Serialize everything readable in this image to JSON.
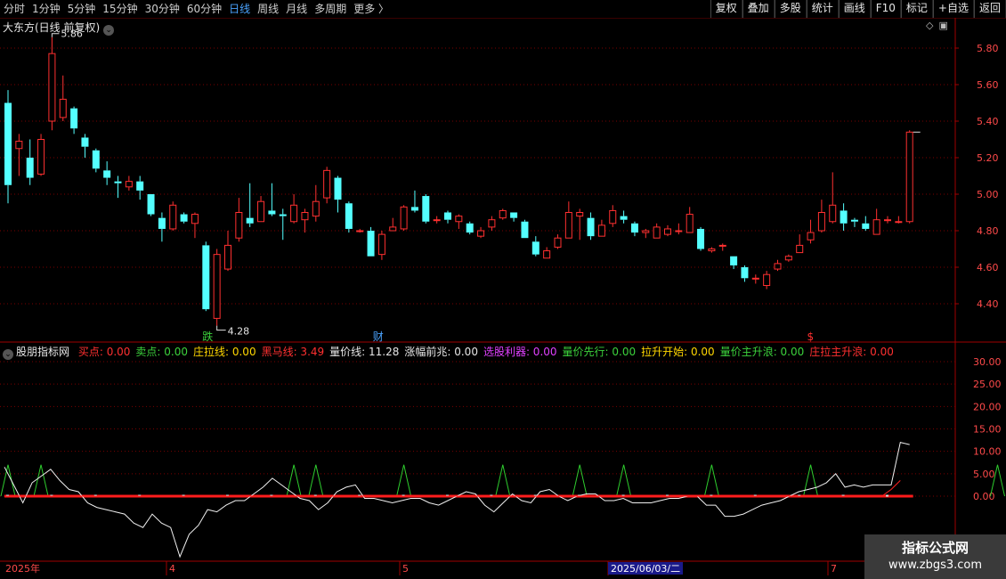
{
  "toolbar": {
    "periods": [
      "分时",
      "1分钟",
      "5分钟",
      "15分钟",
      "30分钟",
      "60分钟",
      "日线",
      "周线",
      "月线",
      "多周期",
      "更多 〉"
    ],
    "active_period": "日线",
    "buttons": [
      "复权",
      "叠加",
      "多股",
      "统计",
      "画线",
      "F10",
      "标记",
      "+自选",
      "返回"
    ]
  },
  "chart_title": "大东方(日线 前复权)",
  "price_axis": [
    "5.80",
    "5.60",
    "5.40",
    "5.20",
    "5.00",
    "4.80",
    "4.60",
    "4.40"
  ],
  "high_label": "5.86",
  "low_label": "4.28",
  "markers": [
    {
      "text": "跌",
      "color": "#3cd23c"
    },
    {
      "text": "财",
      "color": "#4aa3ff"
    },
    {
      "text": "$",
      "color": "#ff3030"
    }
  ],
  "indicator": {
    "name": "股朋指标网",
    "items": [
      {
        "label": "买点: 0.00",
        "color": "#ff3030"
      },
      {
        "label": "卖点: 0.00",
        "color": "#3cd23c"
      },
      {
        "label": "庄拉线: 0.00",
        "color": "#ffd700"
      },
      {
        "label": "黑马线: 3.49",
        "color": "#ff3030"
      },
      {
        "label": "量价线: 11.28",
        "color": "#e6e6e6"
      },
      {
        "label": "涨幅前兆: 0.00",
        "color": "#e6e6e6"
      },
      {
        "label": "选股利器: 0.00",
        "color": "#e040ff"
      },
      {
        "label": "量价先行: 0.00",
        "color": "#3cd23c"
      },
      {
        "label": "拉升开始: 0.00",
        "color": "#ffd700"
      },
      {
        "label": "量价主升浪: 0.00",
        "color": "#3cd23c"
      },
      {
        "label": "庄拉主升浪: 0.00",
        "color": "#ff3030"
      }
    ]
  },
  "indicator_axis": [
    "30.00",
    "25.00",
    "20.00",
    "15.00",
    "10.00",
    "5.00",
    "0.00"
  ],
  "time_axis": [
    "2025年",
    "4",
    "5",
    "2025/06/03/二",
    "7"
  ],
  "watermark": {
    "line1": "指标公式网",
    "line2": "www.zbgs3.com"
  },
  "colors": {
    "up": "#ff3030",
    "down": "#54ffff",
    "grid": "#7a0000",
    "axis_text": "#ff4a4a"
  },
  "candles": [
    [
      5.5,
      5.05,
      5.57,
      4.95
    ],
    [
      5.25,
      5.29,
      5.33,
      5.1
    ],
    [
      5.2,
      5.09,
      5.3,
      5.05
    ],
    [
      5.11,
      5.3,
      5.33,
      5.1
    ],
    [
      5.4,
      5.77,
      5.86,
      5.35
    ],
    [
      5.42,
      5.52,
      5.65,
      5.4
    ],
    [
      5.47,
      5.36,
      5.48,
      5.33
    ],
    [
      5.31,
      5.26,
      5.33,
      5.2
    ],
    [
      5.24,
      5.14,
      5.25,
      5.12
    ],
    [
      5.13,
      5.09,
      5.18,
      5.05
    ],
    [
      5.07,
      5.06,
      5.1,
      4.98
    ],
    [
      5.04,
      5.07,
      5.1,
      5.02
    ],
    [
      5.07,
      5.02,
      5.1,
      4.97
    ],
    [
      5.0,
      4.89,
      5.0,
      4.88
    ],
    [
      4.87,
      4.81,
      4.9,
      4.74
    ],
    [
      4.81,
      4.94,
      4.96,
      4.8
    ],
    [
      4.89,
      4.85,
      4.9,
      4.84
    ],
    [
      4.84,
      4.89,
      4.9,
      4.76
    ],
    [
      4.72,
      4.37,
      4.74,
      4.36
    ],
    [
      4.32,
      4.67,
      4.7,
      4.28
    ],
    [
      4.59,
      4.72,
      4.8,
      4.58
    ],
    [
      4.76,
      4.9,
      4.98,
      4.74
    ],
    [
      4.87,
      4.84,
      5.06,
      4.82
    ],
    [
      4.85,
      4.96,
      4.99,
      4.85
    ],
    [
      4.91,
      4.89,
      5.06,
      4.88
    ],
    [
      4.89,
      4.88,
      4.92,
      4.75
    ],
    [
      4.85,
      4.94,
      5.0,
      4.84
    ],
    [
      4.86,
      4.9,
      4.92,
      4.79
    ],
    [
      4.88,
      4.96,
      5.05,
      4.85
    ],
    [
      4.98,
      5.13,
      5.15,
      4.95
    ],
    [
      5.09,
      4.97,
      5.1,
      4.9
    ],
    [
      4.95,
      4.81,
      4.96,
      4.79
    ],
    [
      4.8,
      4.8,
      4.81,
      4.79
    ],
    [
      4.8,
      4.66,
      4.82,
      4.66
    ],
    [
      4.67,
      4.78,
      4.8,
      4.64
    ],
    [
      4.8,
      4.82,
      4.87,
      4.8
    ],
    [
      4.81,
      4.93,
      4.94,
      4.8
    ],
    [
      4.93,
      4.91,
      5.02,
      4.9
    ],
    [
      4.99,
      4.85,
      5.0,
      4.84
    ],
    [
      4.86,
      4.86,
      4.88,
      4.84
    ],
    [
      4.9,
      4.86,
      4.91,
      4.84
    ],
    [
      4.85,
      4.88,
      4.89,
      4.81
    ],
    [
      4.84,
      4.79,
      4.85,
      4.78
    ],
    [
      4.77,
      4.8,
      4.82,
      4.76
    ],
    [
      4.82,
      4.86,
      4.88,
      4.8
    ],
    [
      4.87,
      4.91,
      4.92,
      4.86
    ],
    [
      4.9,
      4.87,
      4.9,
      4.85
    ],
    [
      4.85,
      4.76,
      4.86,
      4.76
    ],
    [
      4.74,
      4.67,
      4.77,
      4.66
    ],
    [
      4.65,
      4.69,
      4.71,
      4.65
    ],
    [
      4.71,
      4.76,
      4.78,
      4.7
    ],
    [
      4.76,
      4.9,
      4.96,
      4.76
    ],
    [
      4.88,
      4.9,
      4.92,
      4.75
    ],
    [
      4.87,
      4.77,
      4.9,
      4.75
    ],
    [
      4.77,
      4.83,
      4.86,
      4.77
    ],
    [
      4.84,
      4.91,
      4.94,
      4.82
    ],
    [
      4.88,
      4.86,
      4.91,
      4.84
    ],
    [
      4.84,
      4.79,
      4.85,
      4.77
    ],
    [
      4.79,
      4.8,
      4.81,
      4.76
    ],
    [
      4.76,
      4.82,
      4.84,
      4.76
    ],
    [
      4.78,
      4.81,
      4.83,
      4.77
    ],
    [
      4.8,
      4.8,
      4.84,
      4.78
    ],
    [
      4.79,
      4.89,
      4.93,
      4.79
    ],
    [
      4.81,
      4.7,
      4.82,
      4.69
    ],
    [
      4.69,
      4.7,
      4.71,
      4.68
    ],
    [
      4.72,
      4.72,
      4.73,
      4.69
    ],
    [
      4.66,
      4.61,
      4.66,
      4.59
    ],
    [
      4.6,
      4.54,
      4.61,
      4.52
    ],
    [
      4.54,
      4.54,
      4.56,
      4.51
    ],
    [
      4.5,
      4.56,
      4.58,
      4.48
    ],
    [
      4.59,
      4.62,
      4.64,
      4.58
    ],
    [
      4.64,
      4.66,
      4.67,
      4.63
    ],
    [
      4.68,
      4.72,
      4.78,
      4.68
    ],
    [
      4.75,
      4.79,
      4.86,
      4.73
    ],
    [
      4.8,
      4.9,
      4.97,
      4.79
    ],
    [
      4.85,
      4.94,
      5.12,
      4.84
    ],
    [
      4.91,
      4.84,
      4.95,
      4.8
    ],
    [
      4.86,
      4.85,
      4.87,
      4.82
    ],
    [
      4.84,
      4.81,
      4.88,
      4.8
    ],
    [
      4.78,
      4.86,
      4.92,
      4.78
    ],
    [
      4.86,
      4.86,
      4.88,
      4.84
    ],
    [
      4.85,
      4.85,
      4.88,
      4.84
    ],
    [
      4.85,
      5.34,
      5.35,
      4.84
    ]
  ],
  "indicator_white": [
    6.5,
    2.5,
    -1.5,
    3,
    4.5,
    6,
    3.5,
    1.5,
    1,
    -1.5,
    -2.5,
    -3,
    -3.5,
    -4,
    -6,
    -7,
    -4,
    -6,
    -7,
    -13.5,
    -8.5,
    -6.5,
    -3,
    -3.5,
    -2,
    -1,
    -1,
    0.5,
    2,
    4,
    2.5,
    1,
    -0.5,
    -1,
    -3,
    -1.5,
    1,
    2,
    2.5,
    -0.5,
    -0.5,
    -1,
    -1.5,
    -1,
    -0.5,
    -0.5,
    -1.5,
    -2,
    -1,
    0,
    1,
    0.5,
    -2,
    -3.5,
    -1.5,
    0.5,
    -1,
    -1.5,
    1,
    1.5,
    0,
    -1,
    0,
    0.5,
    0.5,
    -1,
    -1,
    -0.5,
    -1.5,
    -1.5,
    -1.5,
    -1,
    -0.5,
    -0.5,
    0,
    0,
    -2,
    -2,
    -4.5,
    -4.5,
    -4,
    -3,
    -2,
    -1.5,
    -1,
    0,
    1,
    1.5,
    2,
    3,
    5,
    2,
    2.5,
    2,
    2.5,
    2.5,
    2.5,
    12,
    11.5
  ],
  "indicator_red": [
    0,
    0,
    0,
    0,
    0,
    0,
    0,
    0,
    0,
    0,
    0,
    0,
    0,
    0,
    0,
    0,
    0,
    0,
    0,
    0,
    0,
    0,
    0,
    0,
    0,
    0,
    0,
    0,
    0,
    0,
    0,
    0,
    0,
    0,
    0,
    0,
    0,
    0,
    0,
    0,
    0,
    0,
    0,
    0,
    0,
    0,
    0,
    0,
    0,
    0,
    0,
    0,
    0,
    0,
    0,
    0,
    0,
    0,
    0,
    0,
    0,
    0,
    0,
    0,
    0,
    0,
    0,
    0,
    0,
    0,
    0,
    0,
    0,
    0,
    0,
    0,
    0,
    0,
    0,
    0,
    0,
    0,
    0,
    0,
    0,
    0,
    0,
    0,
    0,
    0,
    0,
    0,
    0,
    0,
    0,
    0,
    1.5,
    3.49
  ],
  "indicator_green_peaks": [
    0,
    3,
    26,
    28,
    36,
    45,
    52,
    56,
    64,
    73,
    90
  ]
}
